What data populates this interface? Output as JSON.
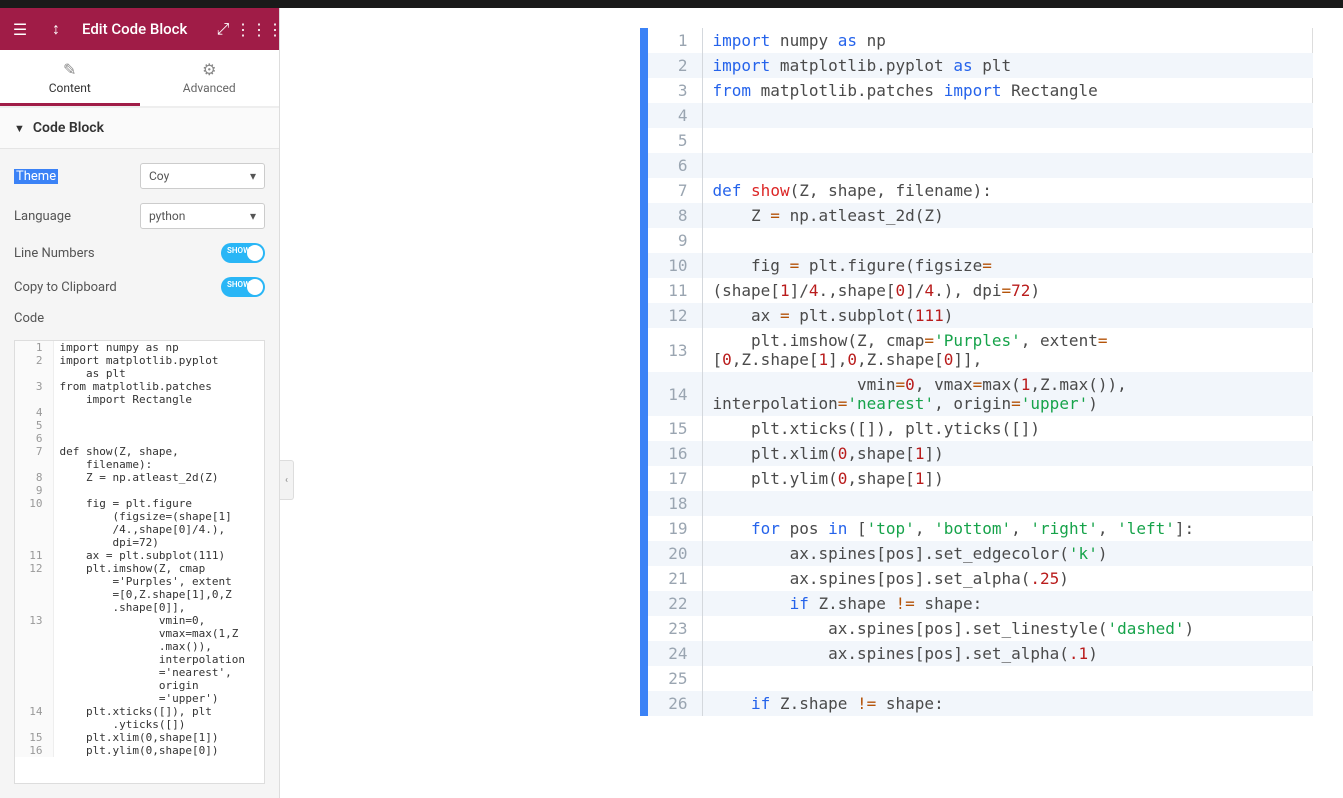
{
  "header": {
    "title": "Edit Code Block"
  },
  "tabs": {
    "content": "Content",
    "advanced": "Advanced"
  },
  "section": {
    "title": "Code Block"
  },
  "controls": {
    "theme_label": "Theme",
    "theme_value": "Coy",
    "language_label": "Language",
    "language_value": "python",
    "line_numbers_label": "Line Numbers",
    "copy_label": "Copy to Clipboard",
    "toggle_text": "SHOW",
    "code_label": "Code"
  },
  "mini_code": [
    {
      "n": "1",
      "t": "import numpy as np"
    },
    {
      "n": "2",
      "t": "import matplotlib.pyplot\n    as plt"
    },
    {
      "n": "3",
      "t": "from matplotlib.patches\n    import Rectangle"
    },
    {
      "n": "4",
      "t": ""
    },
    {
      "n": "5",
      "t": ""
    },
    {
      "n": "6",
      "t": ""
    },
    {
      "n": "7",
      "t": "def show(Z, shape,\n    filename):"
    },
    {
      "n": "8",
      "t": "    Z = np.atleast_2d(Z)"
    },
    {
      "n": "9",
      "t": ""
    },
    {
      "n": "10",
      "t": "    fig = plt.figure\n        (figsize=(shape[1]\n        /4.,shape[0]/4.),\n        dpi=72)"
    },
    {
      "n": "11",
      "t": "    ax = plt.subplot(111)"
    },
    {
      "n": "12",
      "t": "    plt.imshow(Z, cmap\n        ='Purples', extent\n        =[0,Z.shape[1],0,Z\n        .shape[0]],"
    },
    {
      "n": "13",
      "t": "               vmin=0,\n               vmax=max(1,Z\n               .max()),\n               interpolation\n               ='nearest',\n               origin\n               ='upper')"
    },
    {
      "n": "14",
      "t": "    plt.xticks([]), plt\n        .yticks([])"
    },
    {
      "n": "15",
      "t": "    plt.xlim(0,shape[1])"
    },
    {
      "n": "16",
      "t": "    plt.ylim(0,shape[0])"
    }
  ],
  "main_code": [
    {
      "n": "1",
      "h": "<span class='kw'>import</span> numpy <span class='kw'>as</span> np"
    },
    {
      "n": "2",
      "h": "<span class='kw'>import</span> matplotlib.pyplot <span class='kw'>as</span> plt"
    },
    {
      "n": "3",
      "h": "<span class='kw'>from</span> matplotlib.patches <span class='kw'>import</span> Rectangle"
    },
    {
      "n": "4",
      "h": ""
    },
    {
      "n": "5",
      "h": ""
    },
    {
      "n": "6",
      "h": ""
    },
    {
      "n": "7",
      "h": "<span class='kw'>def</span> <span class='fn'>show</span>(Z, shape, filename):"
    },
    {
      "n": "8",
      "h": "    Z <span class='op'>=</span> np.atleast_2d(Z)"
    },
    {
      "n": "9",
      "h": ""
    },
    {
      "n": "10",
      "h": "    fig <span class='op'>=</span> plt.figure(figsize<span class='op'>=</span>"
    },
    {
      "n": "11",
      "h": "(shape[<span class='num'>1</span>]/<span class='num'>4</span>.,shape[<span class='num'>0</span>]/<span class='num'>4</span>.), dpi<span class='op'>=</span><span class='num'>72</span>)"
    },
    {
      "n": "12",
      "h": "    ax <span class='op'>=</span> plt.subplot(<span class='num'>111</span>)"
    },
    {
      "n": "13",
      "h": "    plt.imshow(Z, cmap<span class='op'>=</span><span class='str'>'Purples'</span>, extent<span class='op'>=</span>\n[<span class='num'>0</span>,Z.shape[<span class='num'>1</span>],<span class='num'>0</span>,Z.shape[<span class='num'>0</span>]],"
    },
    {
      "n": "14",
      "h": "               vmin<span class='op'>=</span><span class='num'>0</span>, vmax<span class='op'>=</span>max(<span class='num'>1</span>,Z.max()),\ninterpolation<span class='op'>=</span><span class='str'>'nearest'</span>, origin<span class='op'>=</span><span class='str'>'upper'</span>)"
    },
    {
      "n": "15",
      "h": "    plt.xticks([]), plt.yticks([])"
    },
    {
      "n": "16",
      "h": "    plt.xlim(<span class='num'>0</span>,shape[<span class='num'>1</span>])"
    },
    {
      "n": "17",
      "h": "    plt.ylim(<span class='num'>0</span>,shape[<span class='num'>1</span>])"
    },
    {
      "n": "18",
      "h": ""
    },
    {
      "n": "19",
      "h": "    <span class='kw'>for</span> pos <span class='kw'>in</span> [<span class='str'>'top'</span>, <span class='str'>'bottom'</span>, <span class='str'>'right'</span>, <span class='str'>'left'</span>]:"
    },
    {
      "n": "20",
      "h": "        ax.spines[pos].set_edgecolor(<span class='str'>'k'</span>)"
    },
    {
      "n": "21",
      "h": "        ax.spines[pos].set_alpha(<span class='num'>.25</span>)"
    },
    {
      "n": "22",
      "h": "        <span class='kw'>if</span> Z.shape <span class='op'>!=</span> shape:"
    },
    {
      "n": "23",
      "h": "            ax.spines[pos].set_linestyle(<span class='str'>'dashed'</span>)"
    },
    {
      "n": "24",
      "h": "            ax.spines[pos].set_alpha(<span class='num'>.1</span>)"
    },
    {
      "n": "25",
      "h": ""
    },
    {
      "n": "26",
      "h": "    <span class='kw'>if</span> Z.shape <span class='op'>!=</span> shape:"
    }
  ]
}
